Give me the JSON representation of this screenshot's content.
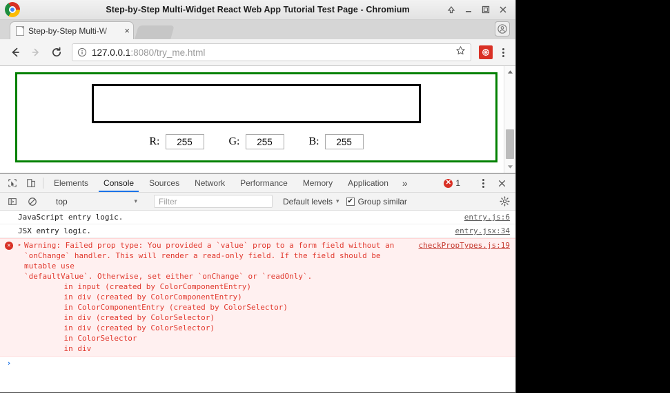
{
  "window": {
    "title": "Step-by-Step Multi-Widget React Web App Tutorial Test Page - Chromium",
    "logo_icon": "chromium-logo-icon",
    "controls": [
      {
        "name": "shade-button",
        "icon": "arrow-up-icon"
      },
      {
        "name": "minimize-button",
        "icon": "minimize-icon"
      },
      {
        "name": "maximize-button",
        "icon": "maximize-icon"
      },
      {
        "name": "close-button",
        "icon": "close-icon"
      }
    ]
  },
  "tabstrip": {
    "tab": {
      "title": "Step-by-Step Multi-W",
      "favicon_icon": "page-favicon-icon",
      "close_label": "×"
    },
    "profile_icon": "profile-avatar-icon"
  },
  "toolbar": {
    "back_icon": "back-arrow-icon",
    "forward_icon": "forward-arrow-icon",
    "reload_icon": "reload-icon",
    "info_icon": "page-info-icon",
    "url_host": "127.0.0.1",
    "url_rest": ":8080/try_me.html",
    "url_full": "127.0.0.1:8080/try_me.html",
    "star_icon": "bookmark-star-icon",
    "extension_icon": "extension-icon",
    "extension_color": "#d93025",
    "menu_icon": "chrome-menu-icon"
  },
  "page": {
    "border_color": "#018000",
    "swatch_color": "#ffffff",
    "swatch_border_color": "#000000",
    "components": [
      {
        "label": "R:",
        "value": "255"
      },
      {
        "label": "G:",
        "value": "255"
      },
      {
        "label": "B:",
        "value": "255"
      }
    ],
    "scrollbar": {
      "up_icon": "scroll-up-arrow-icon",
      "down_icon": "scroll-down-arrow-icon"
    }
  },
  "devtools": {
    "inspect_icon": "inspect-element-icon",
    "device_icon": "device-toolbar-icon",
    "tabs": [
      {
        "label": "Elements",
        "active": false
      },
      {
        "label": "Console",
        "active": true
      },
      {
        "label": "Sources",
        "active": false
      },
      {
        "label": "Network",
        "active": false
      },
      {
        "label": "Performance",
        "active": false
      },
      {
        "label": "Memory",
        "active": false
      },
      {
        "label": "Application",
        "active": false
      }
    ],
    "overflow_label": "»",
    "error_count": "1",
    "error_icon": "error-badge-icon",
    "accent_color": "#1a73e8",
    "more_icon": "more-options-icon",
    "close_icon": "close-devtools-icon",
    "console_toolbar": {
      "sidebar_icon": "console-sidebar-icon",
      "clear_icon": "clear-console-icon",
      "context": "top",
      "context_caret": "▾",
      "filter_placeholder": "Filter",
      "levels_label": "Default levels",
      "levels_caret": "▾",
      "group_similar_label": "Group similar",
      "group_similar_checked": true,
      "check_glyph": "✔",
      "settings_icon": "console-settings-icon"
    },
    "messages": [
      {
        "type": "log",
        "text": "JavaScript entry logic.",
        "source": "entry.js:6"
      },
      {
        "type": "log",
        "text": "JSX entry logic.",
        "source": "entry.jsx:34"
      },
      {
        "type": "error",
        "icon": "error-circle-icon",
        "disclosure": "▸",
        "text": "Warning: Failed prop type: You provided a `value` prop to a form field without an\n`onChange` handler. This will render a read-only field. If the field should be mutable use\n`defaultValue`. Otherwise, set either `onChange` or `readOnly`.",
        "source": "checkPropTypes.js:19",
        "stack": "    in input (created by ColorComponentEntry)\n    in div (created by ColorComponentEntry)\n    in ColorComponentEntry (created by ColorSelector)\n    in div (created by ColorSelector)\n    in div (created by ColorSelector)\n    in ColorSelector\n    in div"
      }
    ],
    "prompt_caret": "›"
  }
}
